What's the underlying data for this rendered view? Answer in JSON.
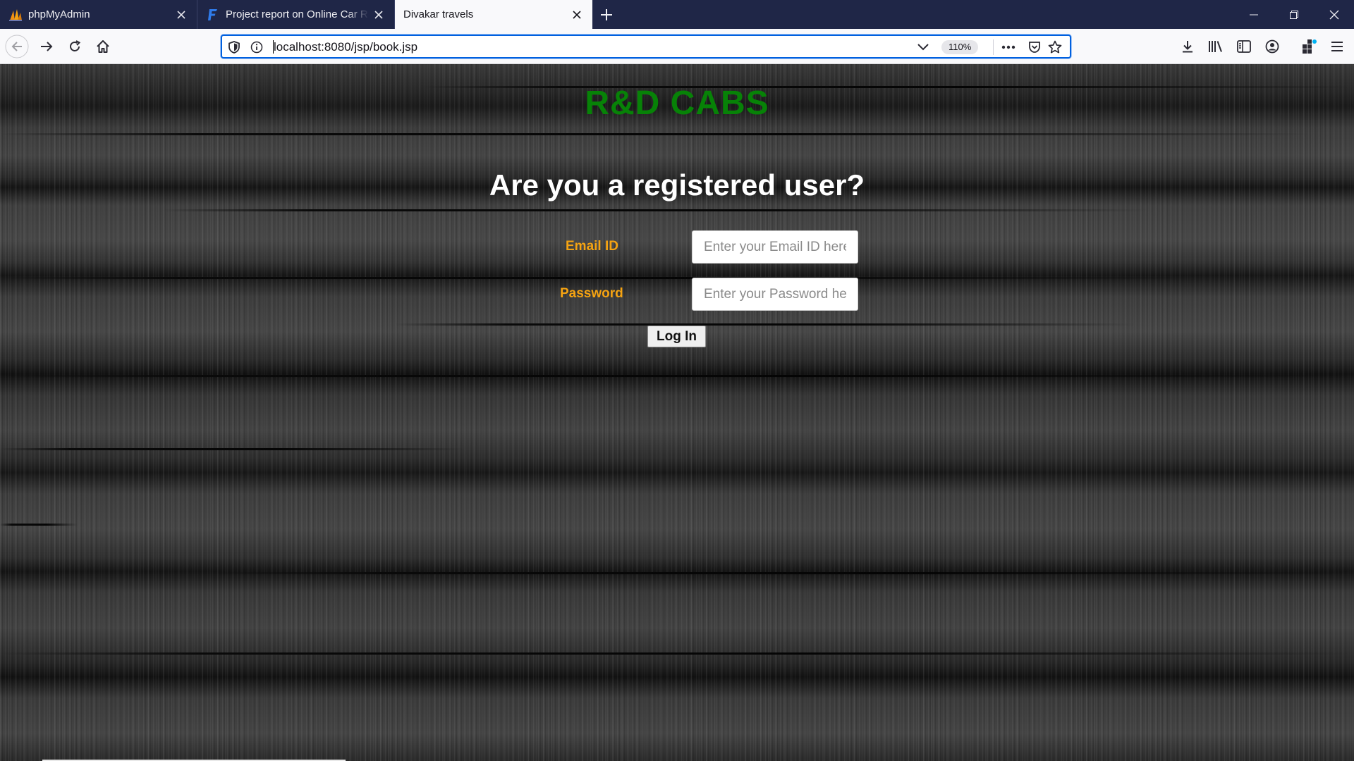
{
  "browser": {
    "tabs": [
      {
        "title": "phpMyAdmin",
        "icon": "phpmyadmin-sail-icon",
        "active": false
      },
      {
        "title": "Project report on Online Car Rental",
        "icon": "f-letter-icon",
        "active": false
      },
      {
        "title": "Divakar travels",
        "icon": "",
        "active": true
      }
    ],
    "url": "localhost:8080/jsp/book.jsp",
    "zoom": "110%",
    "colors": {
      "tabstrip": "#1f2647",
      "toolbar": "#f9f9fb",
      "focus_ring": "#0060df"
    }
  },
  "page": {
    "site_title": "R&D CABS",
    "question": "Are you a registered user?",
    "email": {
      "label": "Email ID",
      "placeholder": "Enter your Email ID here",
      "value": ""
    },
    "password": {
      "label": "Password",
      "placeholder": "Enter your Password here",
      "value": ""
    },
    "login_label": "Log In",
    "colors": {
      "title": "#078207",
      "label": "#f5a312",
      "heading": "#ffffff"
    }
  }
}
